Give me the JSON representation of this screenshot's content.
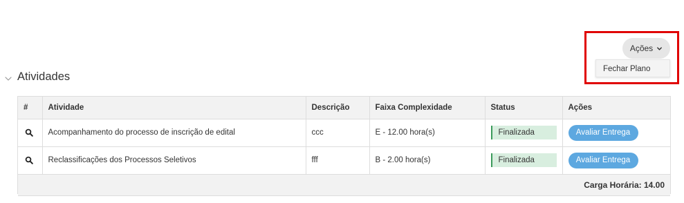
{
  "actions": {
    "button_label": "Ações",
    "menu_items": [
      {
        "label": "Fechar Plano"
      }
    ]
  },
  "section": {
    "title": "Atividades"
  },
  "table": {
    "headers": [
      "#",
      "Atividade",
      "Descrição",
      "Faixa Complexidade",
      "Status",
      "Ações"
    ],
    "rows": [
      {
        "atividade": "Acompanhamento do processo de inscrição de edital",
        "descricao": "ccc",
        "faixa": "E - 12.00 hora(s)",
        "status": "Finalizada",
        "acao": "Avaliar Entrega"
      },
      {
        "atividade": "Reclassificações dos Processos Seletivos",
        "descricao": "fff",
        "faixa": "B - 2.00 hora(s)",
        "status": "Finalizada",
        "acao": "Avaliar Entrega"
      }
    ],
    "footer": "Carga Horária: 14.00"
  },
  "colors": {
    "highlight": "#e00000",
    "status_bg": "#d8eedf",
    "status_border": "#3a9a5a",
    "button_blue": "#5da8e0",
    "header_bg": "#f2f2f2"
  },
  "icons": {
    "row_view": "search-icon",
    "dropdown": "chevron-down-icon",
    "section_toggle": "chevron-down-icon"
  }
}
